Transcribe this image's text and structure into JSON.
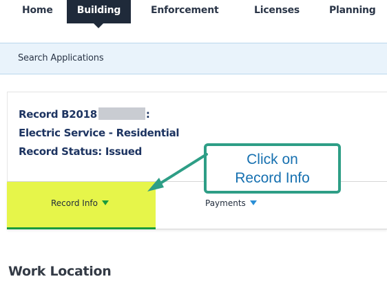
{
  "nav": {
    "tabs": [
      {
        "label": "Home"
      },
      {
        "label": "Building"
      },
      {
        "label": "Enforcement"
      },
      {
        "label": "Licenses"
      },
      {
        "label": "Planning"
      }
    ],
    "active_index": 1
  },
  "search": {
    "label": "Search Applications"
  },
  "record": {
    "number_prefix": "Record B2018",
    "number_suffix": ":",
    "type": "Electric Service - Residential",
    "status": "Record Status: Issued"
  },
  "tabs": {
    "record_info": "Record Info",
    "payments": "Payments"
  },
  "callout": {
    "line1": "Click on",
    "line2": "Record Info"
  },
  "section": {
    "work_location": "Work Location"
  },
  "colors": {
    "nav_active_bg": "#1f2a3a",
    "record_tab_highlight": "#e6f54a",
    "green_caret": "#1a9b3d",
    "blue_caret": "#2a8fd6",
    "callout_border": "#2e9e86",
    "callout_text": "#1670b0",
    "record_text": "#1d3461"
  },
  "icons": {
    "record_tab_caret": "caret-down-icon",
    "payments_caret": "caret-down-icon",
    "annotation_arrow": "arrow-icon"
  }
}
